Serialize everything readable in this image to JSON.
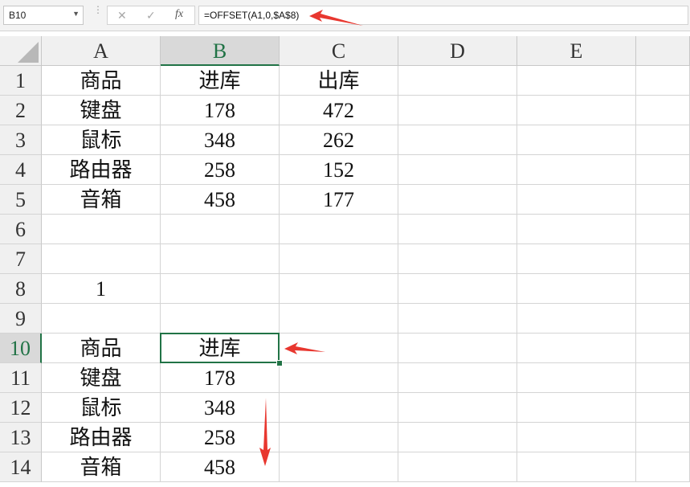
{
  "name_box": {
    "value": "B10"
  },
  "formula_bar": {
    "cancel_glyph": "✕",
    "enter_glyph": "✓",
    "fx_label": "fx",
    "formula": "=OFFSET(A1,0,$A$8)"
  },
  "sheet": {
    "active_cell": "B10",
    "columns": [
      "A",
      "B",
      "C",
      "D",
      "E"
    ],
    "rows": [
      {
        "row": "1",
        "cells": [
          "商品",
          "进库",
          "出库",
          "",
          ""
        ]
      },
      {
        "row": "2",
        "cells": [
          "键盘",
          "178",
          "472",
          "",
          ""
        ]
      },
      {
        "row": "3",
        "cells": [
          "鼠标",
          "348",
          "262",
          "",
          ""
        ]
      },
      {
        "row": "4",
        "cells": [
          "路由器",
          "258",
          "152",
          "",
          ""
        ]
      },
      {
        "row": "5",
        "cells": [
          "音箱",
          "458",
          "177",
          "",
          ""
        ]
      },
      {
        "row": "6",
        "cells": [
          "",
          "",
          "",
          "",
          ""
        ]
      },
      {
        "row": "7",
        "cells": [
          "",
          "",
          "",
          "",
          ""
        ]
      },
      {
        "row": "8",
        "cells": [
          "1",
          "",
          "",
          "",
          ""
        ]
      },
      {
        "row": "9",
        "cells": [
          "",
          "",
          "",
          "",
          ""
        ]
      },
      {
        "row": "10",
        "cells": [
          "商品",
          "进库",
          "",
          "",
          ""
        ]
      },
      {
        "row": "11",
        "cells": [
          "键盘",
          "178",
          "",
          "",
          ""
        ]
      },
      {
        "row": "12",
        "cells": [
          "鼠标",
          "348",
          "",
          "",
          ""
        ]
      },
      {
        "row": "13",
        "cells": [
          "路由器",
          "258",
          "",
          "",
          ""
        ]
      },
      {
        "row": "14",
        "cells": [
          "音箱",
          "458",
          "",
          "",
          ""
        ]
      }
    ]
  },
  "colors": {
    "excel_green": "#217346",
    "annotation_red": "#e8372f"
  }
}
